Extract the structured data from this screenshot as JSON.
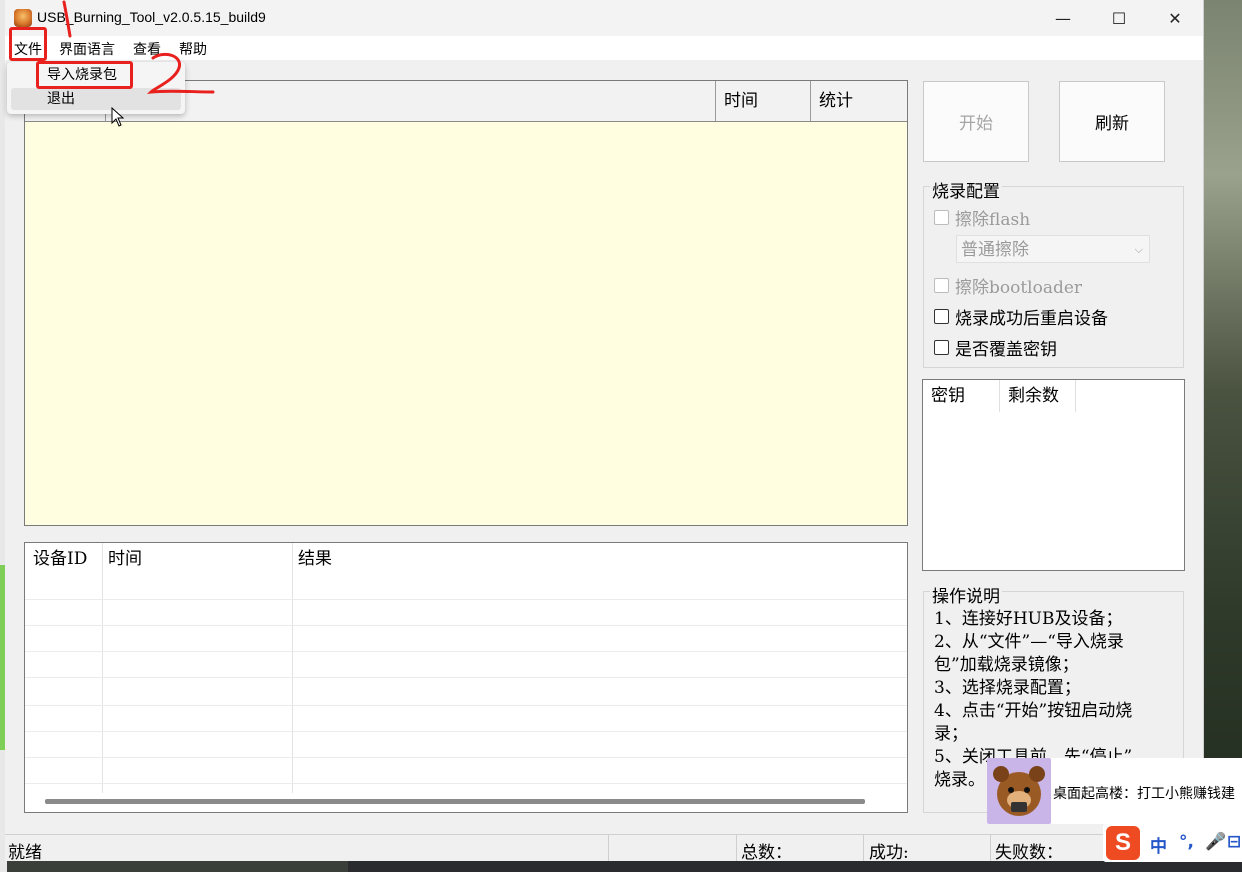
{
  "window": {
    "title": "USB_Burning_Tool_v2.0.5.15_build9",
    "minimize": "—",
    "maximize": "☐",
    "close": "✕"
  },
  "menu": {
    "file": "文件",
    "language": "界面语言",
    "view": "查看",
    "help": "帮助"
  },
  "file_menu": {
    "items": [
      "导入烧录包",
      "退出"
    ]
  },
  "device_list": {
    "columns": [
      "",
      "",
      "时间",
      "统计"
    ]
  },
  "result_list": {
    "columns": [
      "设备ID",
      "时间",
      "结果"
    ]
  },
  "buttons": {
    "start": "开始",
    "refresh": "刷新"
  },
  "burn_config": {
    "title": "烧录配置",
    "erase_flash": "擦除flash",
    "erase_mode": "普通擦除",
    "erase_bootloader": "擦除bootloader",
    "reboot_after": "烧录成功后重启设备",
    "overwrite_key": "是否覆盖密钥"
  },
  "key_table": {
    "columns": [
      "密钥",
      "剩余数"
    ]
  },
  "instructions": {
    "title": "操作说明",
    "lines": [
      "1、连接好HUB及设备；",
      "2、从“文件”—“导入烧录",
      "包”加载烧录镜像；",
      "3、选择烧录配置；",
      "4、点击“开始”按钮启动烧",
      "录；",
      "5、关闭工具前，先“停止”",
      "烧录。"
    ]
  },
  "status": {
    "state": "就绪",
    "total_label": "总数：",
    "success_label": "成功:",
    "fail_label": "失败数："
  },
  "notification": {
    "text": "桌面起高楼：打工小熊赚钱建"
  },
  "ime": {
    "logo": "S",
    "lang": "中",
    "punct": "°,",
    "mic": "🎤",
    "extra": "⊟"
  },
  "annotations": {
    "step1": "1",
    "step2": "2"
  },
  "colors": {
    "highlight": "#e8211e",
    "list_background": "#fffee0"
  }
}
